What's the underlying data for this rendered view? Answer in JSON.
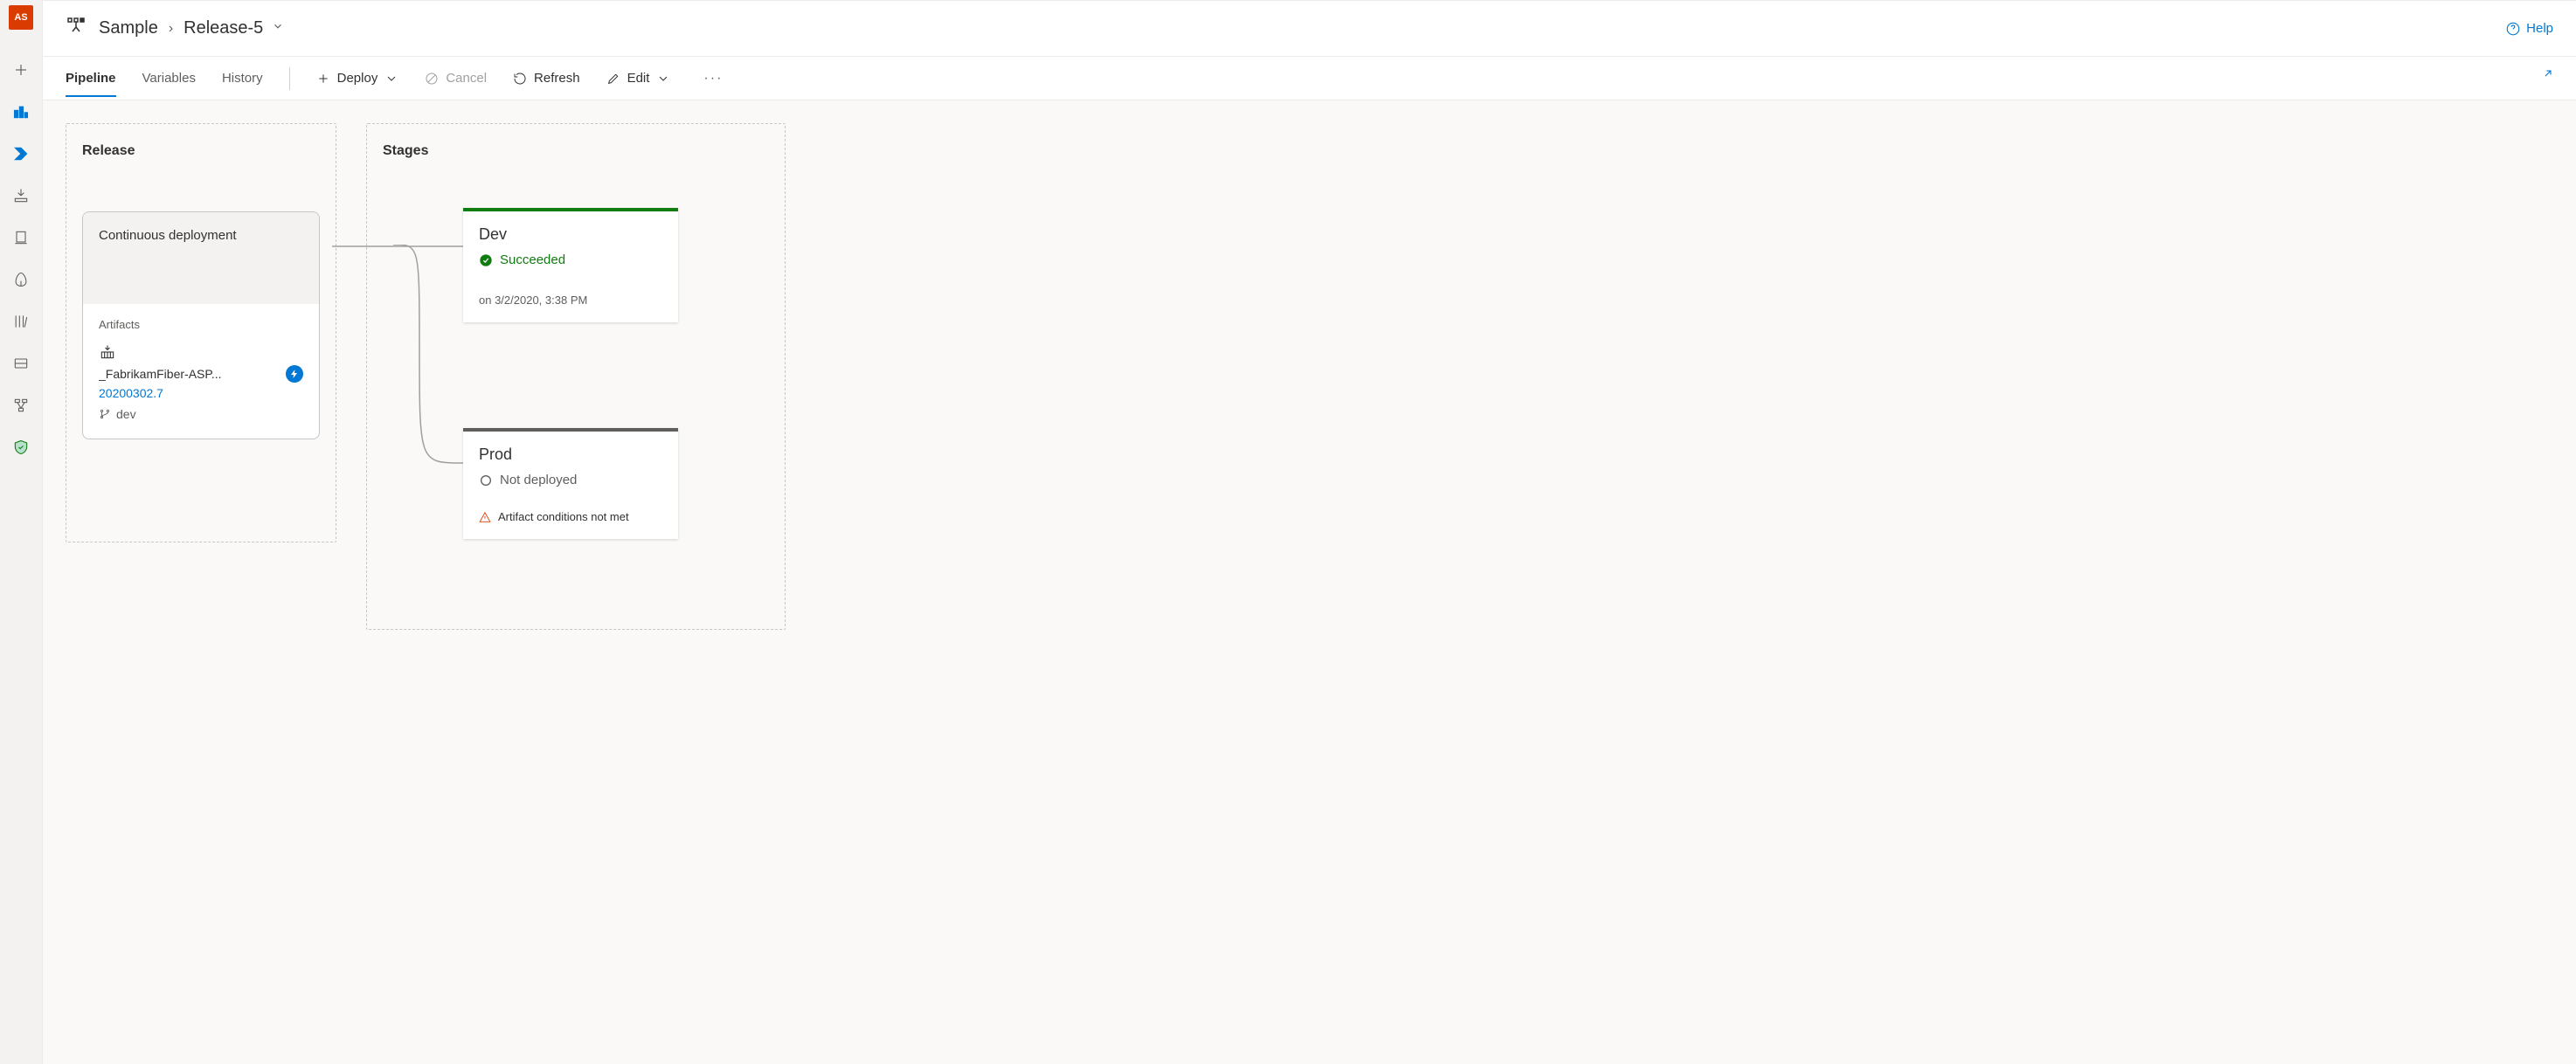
{
  "rail": {
    "avatar_initials": "AS"
  },
  "header": {
    "breadcrumb_root": "Sample",
    "breadcrumb_current": "Release-5",
    "help_label": "Help"
  },
  "tabs": {
    "pipeline": "Pipeline",
    "variables": "Variables",
    "history": "History"
  },
  "toolbar": {
    "deploy_label": "Deploy",
    "cancel_label": "Cancel",
    "refresh_label": "Refresh",
    "edit_label": "Edit"
  },
  "release_panel": {
    "title": "Release",
    "card_title": "Continuous deployment",
    "artifacts_label": "Artifacts",
    "artifact_name": "_FabrikamFiber-ASP...",
    "build_number": "20200302.7",
    "branch": "dev"
  },
  "stages_panel": {
    "title": "Stages",
    "dev": {
      "name": "Dev",
      "status_label": "Succeeded",
      "timestamp": "on 3/2/2020, 3:38 PM"
    },
    "prod": {
      "name": "Prod",
      "status_label": "Not deployed",
      "warning": "Artifact conditions not met"
    }
  }
}
